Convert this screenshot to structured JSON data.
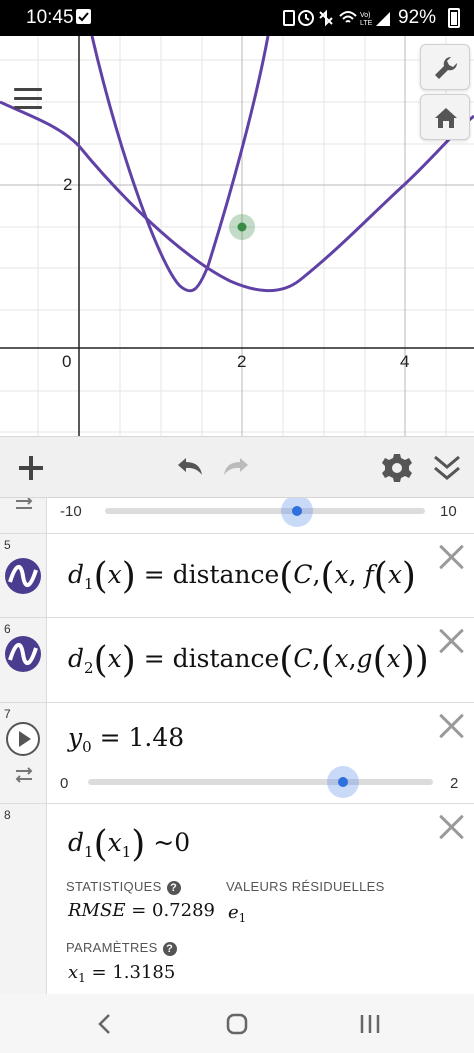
{
  "status_bar": {
    "time": "10:45",
    "battery": "92%"
  },
  "graph": {
    "x_ticks": [
      "0",
      "2",
      "4"
    ],
    "y_ticks": [
      "2"
    ],
    "point_color": "#388c46",
    "curve_color": "#6042a6"
  },
  "toolbar": {
    "add": "add-icon",
    "undo": "undo-icon",
    "redo": "redo-icon",
    "settings": "gear-icon",
    "collapse": "double-chevron-down-icon"
  },
  "expressions": {
    "slider_top": {
      "min": "-10",
      "max": "10",
      "value_fraction": 0.58
    },
    "e5": {
      "number": "5",
      "fn": "d",
      "sub": "1",
      "var": "x",
      "rhs_word": "distance",
      "point": "C",
      "inner_fn": "f"
    },
    "e6": {
      "number": "6",
      "fn": "d",
      "sub": "2",
      "var": "x",
      "rhs_word": "distance",
      "point": "C",
      "inner_fn": "g"
    },
    "e7": {
      "number": "7",
      "name": "y",
      "sub": "0",
      "value": "1.48",
      "min": "0",
      "max": "2",
      "value_fraction": 0.74
    },
    "e8": {
      "number": "8",
      "fn": "d",
      "sub": "1",
      "arg": "x",
      "arg_sub": "1",
      "rel": "~",
      "rhs": "0",
      "statistics_label": "STATISTIQUES",
      "residuals_label": "VALEURS RÉSIDUELLES",
      "rmse_name": "RMSE",
      "rmse_value": "0.7289",
      "residual_name": "e",
      "residual_sub": "1",
      "parameters_label": "PARAMÈTRES",
      "param_name": "x",
      "param_sub": "1",
      "param_value": "1.3185"
    }
  }
}
